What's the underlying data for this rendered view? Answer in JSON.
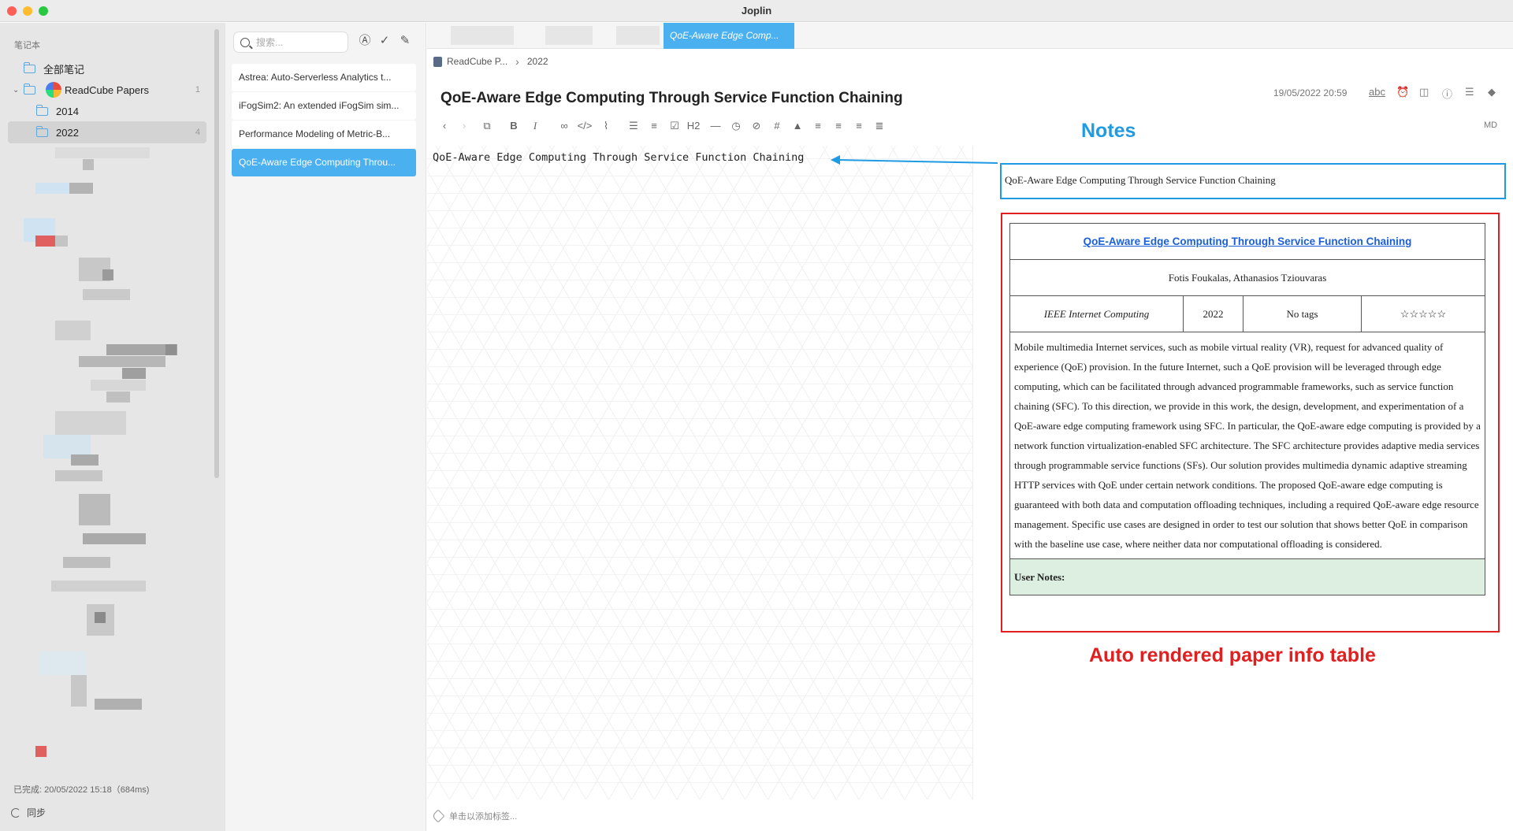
{
  "window": {
    "title": "Joplin"
  },
  "sidebar": {
    "section_label": "笔记本",
    "items": [
      {
        "label": "全部笔记",
        "count": ""
      },
      {
        "label": "ReadCube Papers",
        "count": "1"
      },
      {
        "label": "2014",
        "count": ""
      },
      {
        "label": "2022",
        "count": "4"
      }
    ],
    "status": "已完成: 20/05/2022 15:18（684ms)",
    "sync_label": "同步"
  },
  "note_list": {
    "search_placeholder": "搜索...",
    "items": [
      "Astrea: Auto-Serverless Analytics t...",
      "iFogSim2: An extended iFogSim sim...",
      "Performance Modeling of Metric-B...",
      "QoE-Aware Edge Computing Throu..."
    ]
  },
  "tabs": {
    "active_label": "QoE-Aware Edge Comp..."
  },
  "breadcrumb": {
    "notebook": "ReadCube P...",
    "folder": "2022"
  },
  "note": {
    "title": "QoE-Aware Edge Computing Through Service Function Chaining",
    "date": "19/05/2022 20:59",
    "editor_text": "QoE-Aware Edge Computing Through Service Function Chaining",
    "mode_label": "MD",
    "tag_placeholder": "单击以添加标签..."
  },
  "toolbar": {
    "heading_label": "H2"
  },
  "viewer": {
    "heading_text": "QoE-Aware Edge Computing Through Service Function Chaining",
    "paper": {
      "title": "QoE-Aware Edge Computing Through Service Function Chaining",
      "authors": "Fotis Foukalas, Athanasios Tziouvaras",
      "journal": "IEEE Internet Computing",
      "year": "2022",
      "tags": "No tags",
      "rating": "☆☆☆☆☆",
      "abstract": "Mobile multimedia Internet services, such as mobile virtual reality (VR), request for advanced quality of experience (QoE) provision. In the future Internet, such a QoE provision will be leveraged through edge computing, which can be facilitated through advanced programmable frameworks, such as service function chaining (SFC). To this direction, we provide in this work, the design, development, and experimentation of a QoE-aware edge computing framework using SFC. In particular, the QoE-aware edge computing is provided by a network function virtualization-enabled SFC architecture. The SFC architecture provides adaptive media services through programmable service functions (SFs). Our solution provides multimedia dynamic adaptive streaming HTTP services with QoE under certain network conditions. The proposed QoE-aware edge computing is guaranteed with both data and computation offloading techniques, including a required QoE-aware edge resource management. Specific use cases are designed in order to test our solution that shows better QoE in comparison with the baseline use case, where neither data nor computational offloading is considered.",
      "user_notes_label": "User Notes:"
    }
  },
  "annotations": {
    "notes_label": "Notes",
    "table_label": "Auto rendered paper info table"
  },
  "colors": {
    "accent": "#4ab0ef",
    "annotation_blue": "#1e9be2",
    "annotation_red": "#e02020",
    "user_notes_bg": "#dcefe1"
  }
}
